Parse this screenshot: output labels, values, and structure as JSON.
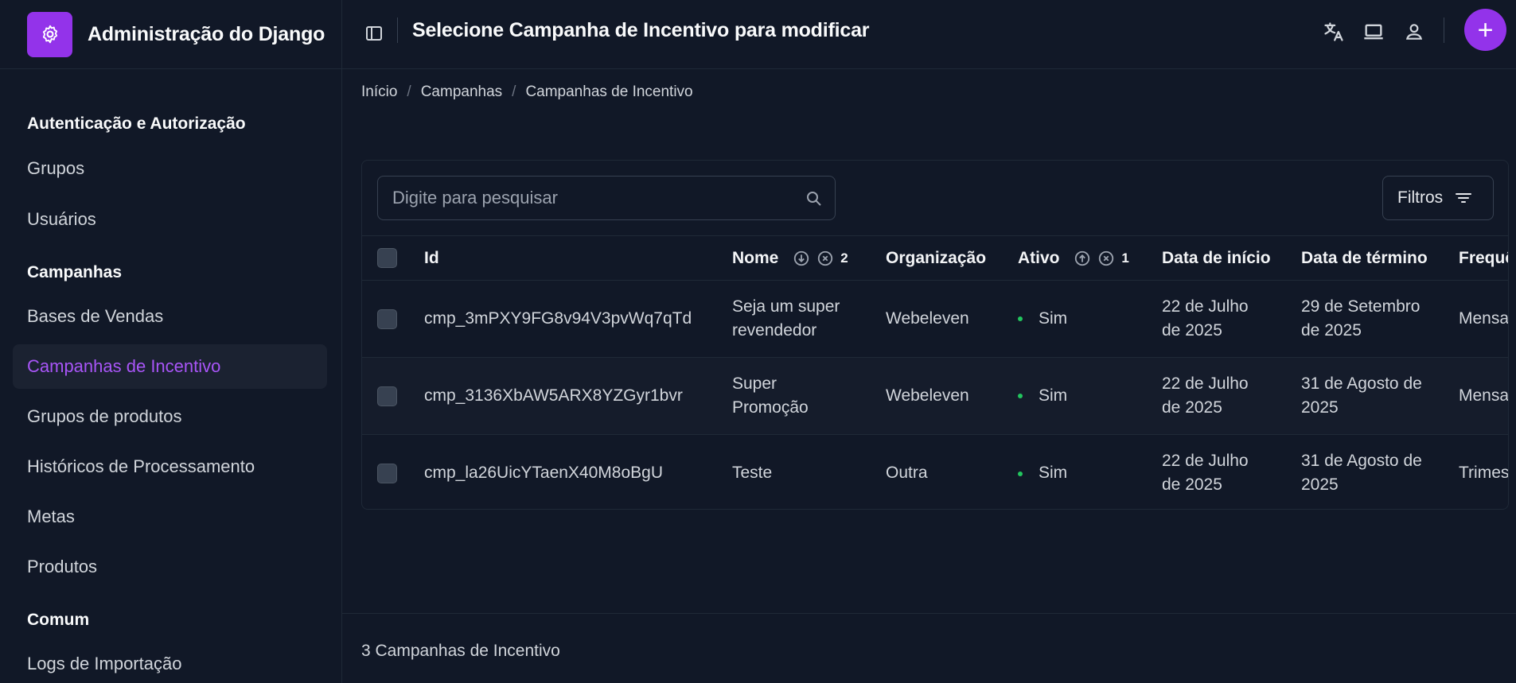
{
  "brand": {
    "title": "Administração do Django",
    "icon": "gear-icon",
    "accent": "#9333ea"
  },
  "sidebar": {
    "sections": [
      {
        "title": "Autenticação e Autorização",
        "items": [
          "Grupos",
          "Usuários"
        ]
      },
      {
        "title": "Campanhas",
        "items": [
          "Bases de Vendas",
          "Campanhas de Incentivo",
          "Grupos de produtos",
          "Históricos de Processamento",
          "Metas",
          "Produtos"
        ]
      },
      {
        "title": "Comum",
        "items": [
          "Logs de Importação"
        ]
      }
    ],
    "active_item": "Campanhas de Incentivo"
  },
  "header": {
    "title": "Selecione Campanha de Incentivo para modificar",
    "icons": [
      "translate-icon",
      "laptop-icon",
      "user-icon"
    ],
    "add_label": "+"
  },
  "breadcrumb": [
    "Início",
    "Campanhas",
    "Campanhas de Incentivo"
  ],
  "search": {
    "placeholder": "Digite para pesquisar",
    "value": ""
  },
  "filters": {
    "label": "Filtros"
  },
  "table": {
    "columns": {
      "id": "Id",
      "nome": "Nome",
      "nome_sort_index": "2",
      "organizacao": "Organização",
      "ativo": "Ativo",
      "ativo_sort_index": "1",
      "data_inicio": "Data de início",
      "data_termino": "Data de término",
      "frequencia": "Frequê"
    },
    "rows": [
      {
        "id": "cmp_3mPXY9FG8v94V3pvWq7qTd",
        "nome_1": "Seja um super",
        "nome_2": "revendedor",
        "organizacao": "Webeleven",
        "ativo": "Sim",
        "inicio_1": "22 de Julho",
        "inicio_2": "de 2025",
        "termino_1": "29 de Setembro",
        "termino_2": "de 2025",
        "frequencia": "Mensal"
      },
      {
        "id": "cmp_3136XbAW5ARX8YZGyr1bvr",
        "nome_1": "Super",
        "nome_2": "Promoção",
        "organizacao": "Webeleven",
        "ativo": "Sim",
        "inicio_1": "22 de Julho",
        "inicio_2": "de 2025",
        "termino_1": "31 de Agosto de",
        "termino_2": "2025",
        "frequencia": "Mensal"
      },
      {
        "id": "cmp_la26UicYTaenX40M8oBgU",
        "nome_1": "Teste",
        "nome_2": "",
        "organizacao": "Outra",
        "ativo": "Sim",
        "inicio_1": "22 de Julho",
        "inicio_2": "de 2025",
        "termino_1": "31 de Agosto de",
        "termino_2": "2025",
        "frequencia": "Trimest"
      }
    ]
  },
  "result_count": "3 Campanhas de Incentivo"
}
